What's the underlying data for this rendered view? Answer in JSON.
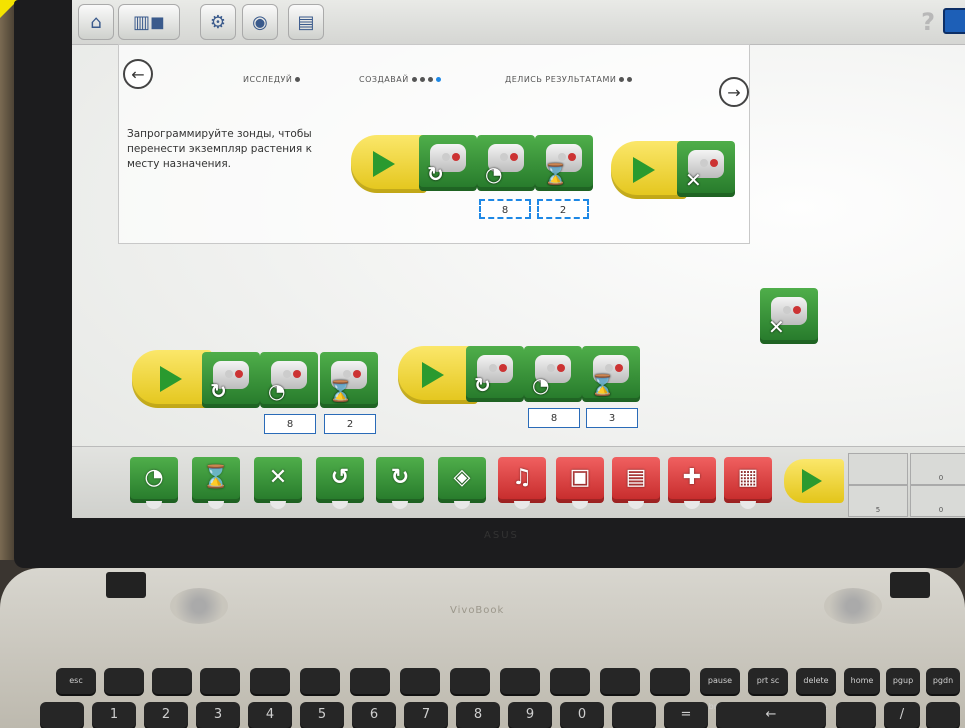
{
  "toolbar": {
    "buttons": [
      "home-icon",
      "library-icon",
      "book-icon",
      "gear-icon",
      "camera-icon",
      "document-icon"
    ],
    "help_label": "?"
  },
  "panel": {
    "back_arrow": "←",
    "next_arrow": "→",
    "steps": [
      "ИССЛЕДУЙ",
      "СОЗДАВАЙ",
      "ДЕЛИСЬ РЕЗУЛЬТАТАМИ"
    ],
    "instruction": "Запрограммируйте зонды, чтобы перенести экземпляр растения к месту назначения."
  },
  "programs": {
    "example_inputs": [
      "8",
      "2"
    ],
    "left_inputs": [
      "8",
      "2"
    ],
    "right_inputs": [
      "8",
      "3"
    ]
  },
  "palette": {
    "green_blocks": [
      "motor-power-icon",
      "wait-icon",
      "motor-stop-icon",
      "motor-reverse-icon",
      "motor-forward-icon",
      "light-icon"
    ],
    "red_blocks": [
      "sound-icon",
      "display-background-icon",
      "display-number-icon",
      "add-to-display-icon",
      "display-collapse-icon"
    ],
    "device_values": [
      "0",
      "5",
      "0"
    ]
  },
  "laptop": {
    "brand": "ASUS",
    "model": "VivoBook",
    "keys_row1": [
      "esc",
      "",
      "",
      "",
      "",
      "",
      "",
      "",
      "",
      "",
      "",
      "",
      "",
      "",
      "pause break",
      "prt sc sysrq",
      "delete insert",
      "home",
      "pgup",
      "pgdn"
    ],
    "keys_row2": [
      "",
      "1",
      "2",
      "3",
      "4",
      "5",
      "6",
      "7",
      "8",
      "9",
      "0",
      "",
      "=",
      "←",
      "",
      "/",
      ""
    ]
  }
}
